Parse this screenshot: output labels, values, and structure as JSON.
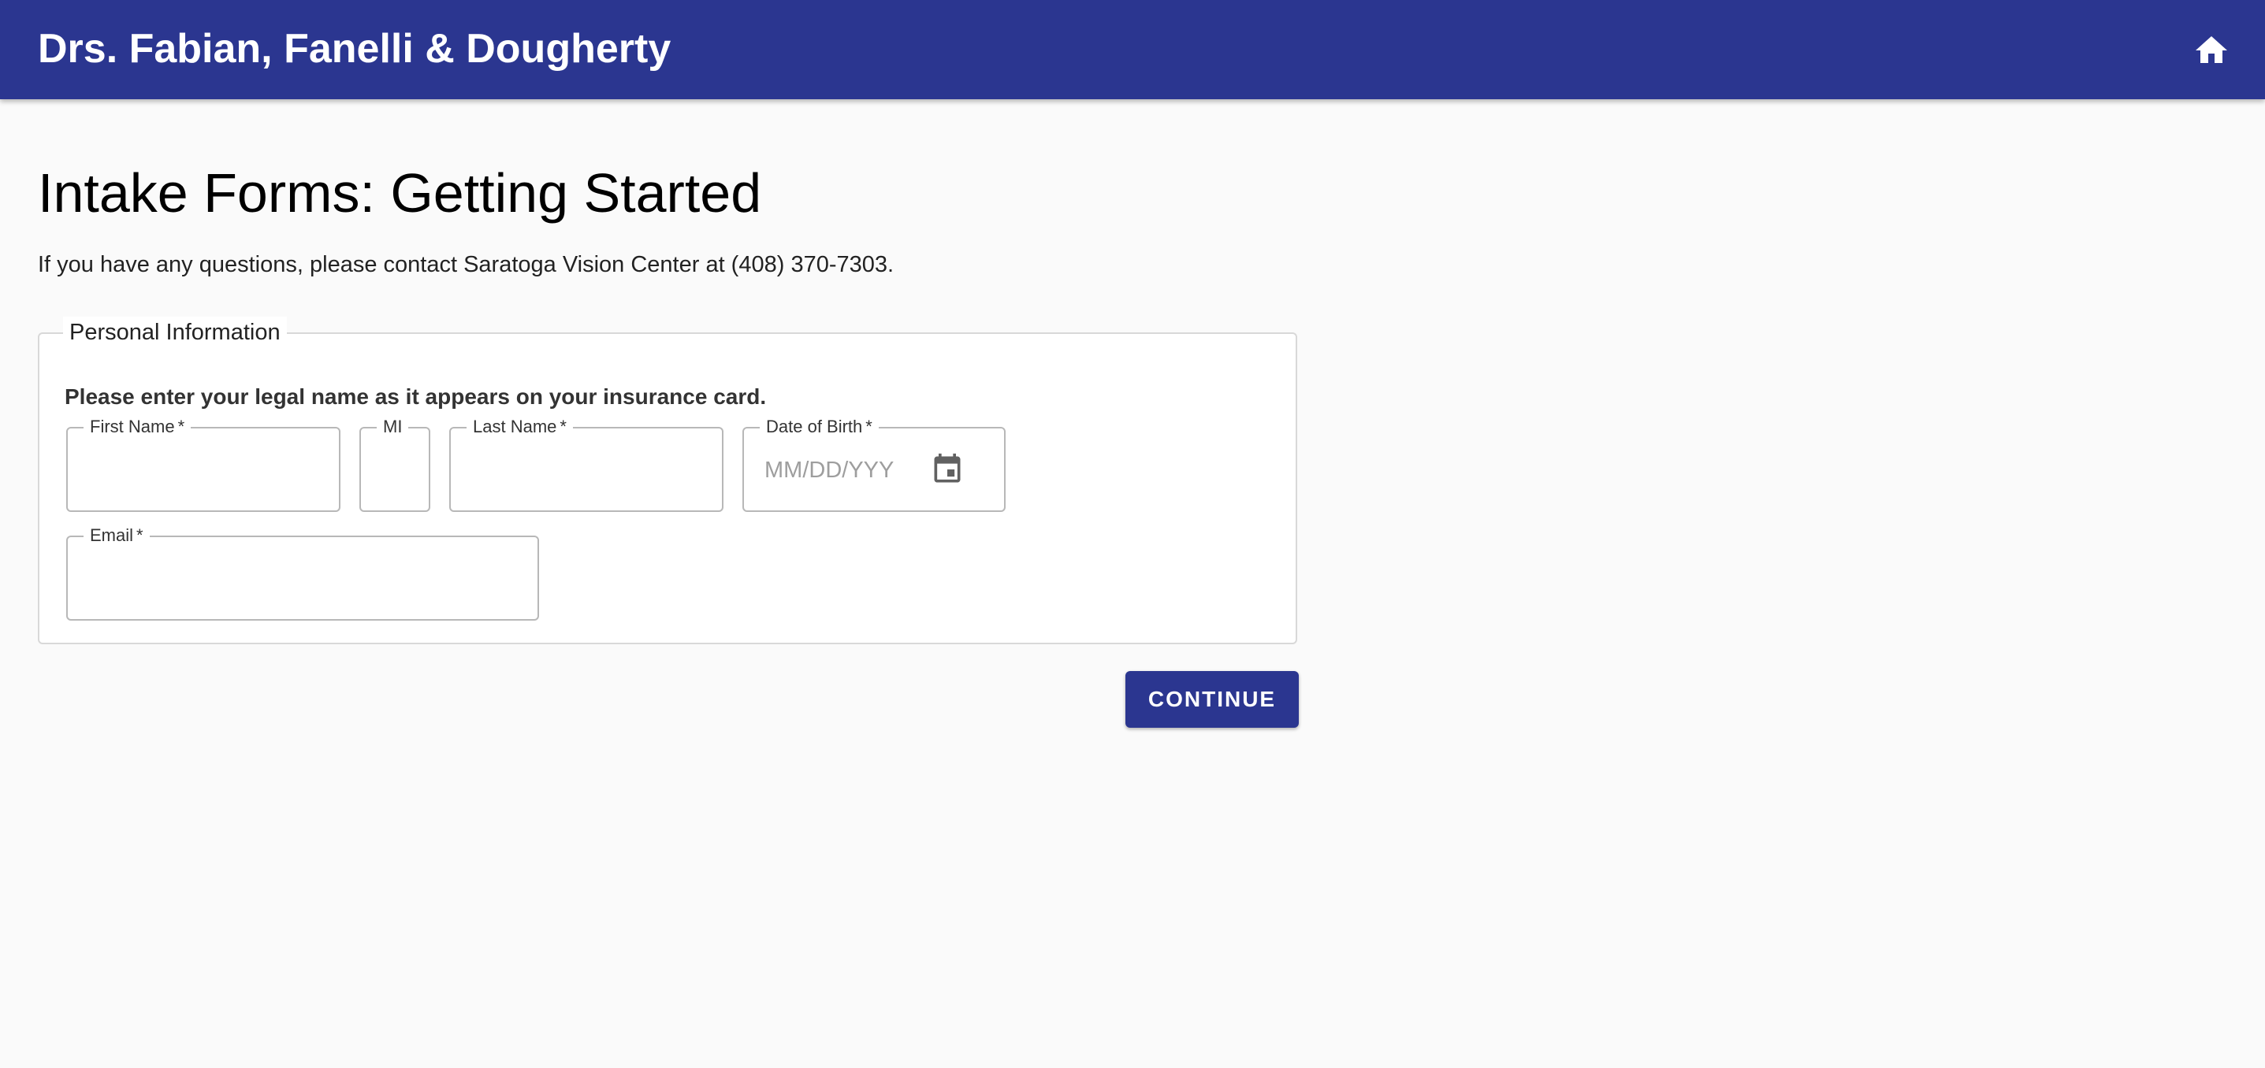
{
  "header": {
    "title": "Drs. Fabian, Fanelli & Dougherty",
    "home_icon": "home-icon"
  },
  "page": {
    "title": "Intake Forms: Getting Started",
    "subtitle": "If you have any questions, please contact Saratoga Vision Center at (408) 370-7303."
  },
  "personal_info": {
    "legend": "Personal Information",
    "instruction": "Please enter your legal name as it appears on your insurance card.",
    "required_marker": "*",
    "fields": {
      "first_name": {
        "label": "First Name",
        "value": "",
        "required": true
      },
      "middle_initial": {
        "label": "MI",
        "value": "",
        "required": false
      },
      "last_name": {
        "label": "Last Name",
        "value": "",
        "required": true
      },
      "date_of_birth": {
        "label": "Date of Birth",
        "value": "",
        "placeholder": "MM/DD/YYY",
        "required": true,
        "icon": "calendar-icon"
      },
      "email": {
        "label": "Email",
        "value": "",
        "required": true
      }
    }
  },
  "actions": {
    "continue_label": "Continue"
  },
  "colors": {
    "brand": "#2b3690",
    "background": "#fafafa",
    "field_border": "#b8b8b8",
    "icon_gray": "#616161"
  }
}
